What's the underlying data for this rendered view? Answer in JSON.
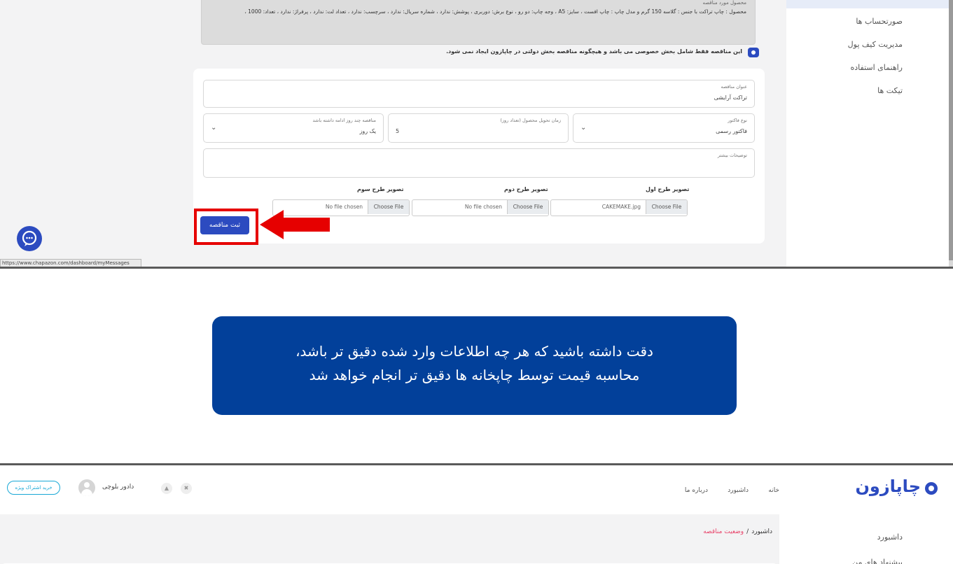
{
  "top": {
    "sidebar_items": [
      "صورتحساب ها",
      "مدیریت کیف پول",
      "راهنمای استفاده",
      "تیکت ها"
    ],
    "description_label": "محصول مورد مناقصه",
    "description_text": "محصول : چاپ تراکت با جنس : گلاسه 150 گرم و مدل چاپ : چاپ افست ، سایز: A5 ، وجه چاپ: دو رو ، نوع برش: دوربری ، پوشش: ندارد ، شماره سریال: ندارد ، سرچسب: ندارد ، تعداد لت: ندارد ، پرفراژ: ندارد ، تعداد: 1000 ،",
    "checkbox_label": "این مناقصه فقط شامل بخش خصوصی می باشد و هیچگونه مناقصه بخش دولتی در چاپازون ایجاد نمی شود.",
    "form": {
      "title_label": "عنوان مناقصه",
      "title_value": "تراکت آرایشی",
      "invoice_label": "نوع فاکتور",
      "invoice_value": "فاکتور رسمی",
      "delivery_label": "زمان تحویل محصول (تعداد روز)",
      "delivery_value": "5",
      "duration_label": "مناقصه چند روز ادامه داشته باشد",
      "duration_value": "یک روز",
      "notes_label": "توضیحات بیشتر",
      "uploads": [
        {
          "title": "تصویر طرح اول",
          "button": "Choose File",
          "file": "CAKEMAKE.jpg"
        },
        {
          "title": "تصویر طرح دوم",
          "button": "Choose File",
          "file": "No file chosen"
        },
        {
          "title": "تصویر طرح سوم",
          "button": "Choose File",
          "file": "No file chosen"
        }
      ],
      "submit_label": "ثبت مناقصه"
    },
    "status_url": "https://www.chapazon.com/dashboard/myMessages"
  },
  "note": {
    "line1": "دقت داشته باشید که هر چه اطلاعات وارد شده دقیق تر باشد،",
    "line2": "محاسبه قیمت توسط چاپخانه ها دقیق تر انجام خواهد شد"
  },
  "bottom": {
    "logo_text": "چاپازون",
    "nav": [
      "خانه",
      "داشبورد",
      "درباره ما"
    ],
    "username": "دادور بلوچی",
    "premium_label": "خرید اشتراک ویژه",
    "breadcrumb": {
      "home": "داشبورد",
      "current": "وضعیت مناقصه",
      "separator": "/"
    },
    "sidebar_items": [
      "داشبورد",
      "پیشنهاد های من"
    ]
  },
  "colors": {
    "accent": "#2c4bc0",
    "note_bg": "#02409a",
    "highlight": "#e60000",
    "breadcrumb_active": "#e8456b"
  }
}
